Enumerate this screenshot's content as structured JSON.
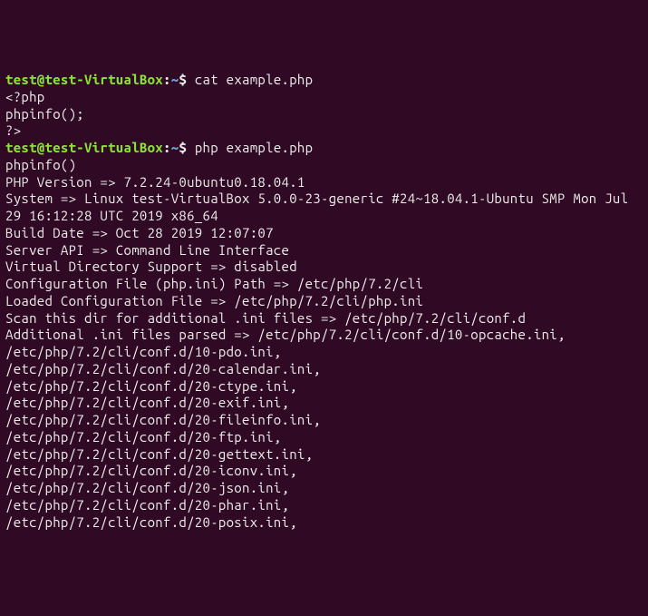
{
  "prompt": {
    "user": "test@test-VirtualBox",
    "colon": ":",
    "path": "~",
    "dollar": "$"
  },
  "commands": {
    "cmd1": "cat example.php",
    "cmd2": "php example.php"
  },
  "output1": {
    "l1": "<?php",
    "l2": "phpinfo();",
    "l3": "?>"
  },
  "output2": {
    "l1": "phpinfo()",
    "l2": "PHP Version => 7.2.24-0ubuntu0.18.04.1",
    "l3": "",
    "l4": "System => Linux test-VirtualBox 5.0.0-23-generic #24~18.04.1-Ubuntu SMP Mon Jul 29 16:12:28 UTC 2019 x86_64",
    "l5": "Build Date => Oct 28 2019 12:07:07",
    "l6": "Server API => Command Line Interface",
    "l7": "Virtual Directory Support => disabled",
    "l8": "Configuration File (php.ini) Path => /etc/php/7.2/cli",
    "l9": "Loaded Configuration File => /etc/php/7.2/cli/php.ini",
    "l10": "Scan this dir for additional .ini files => /etc/php/7.2/cli/conf.d",
    "l11": "Additional .ini files parsed => /etc/php/7.2/cli/conf.d/10-opcache.ini,",
    "l12": "/etc/php/7.2/cli/conf.d/10-pdo.ini,",
    "l13": "/etc/php/7.2/cli/conf.d/20-calendar.ini,",
    "l14": "/etc/php/7.2/cli/conf.d/20-ctype.ini,",
    "l15": "/etc/php/7.2/cli/conf.d/20-exif.ini,",
    "l16": "/etc/php/7.2/cli/conf.d/20-fileinfo.ini,",
    "l17": "/etc/php/7.2/cli/conf.d/20-ftp.ini,",
    "l18": "/etc/php/7.2/cli/conf.d/20-gettext.ini,",
    "l19": "/etc/php/7.2/cli/conf.d/20-iconv.ini,",
    "l20": "/etc/php/7.2/cli/conf.d/20-json.ini,",
    "l21": "/etc/php/7.2/cli/conf.d/20-phar.ini,",
    "l22": "/etc/php/7.2/cli/conf.d/20-posix.ini,"
  }
}
